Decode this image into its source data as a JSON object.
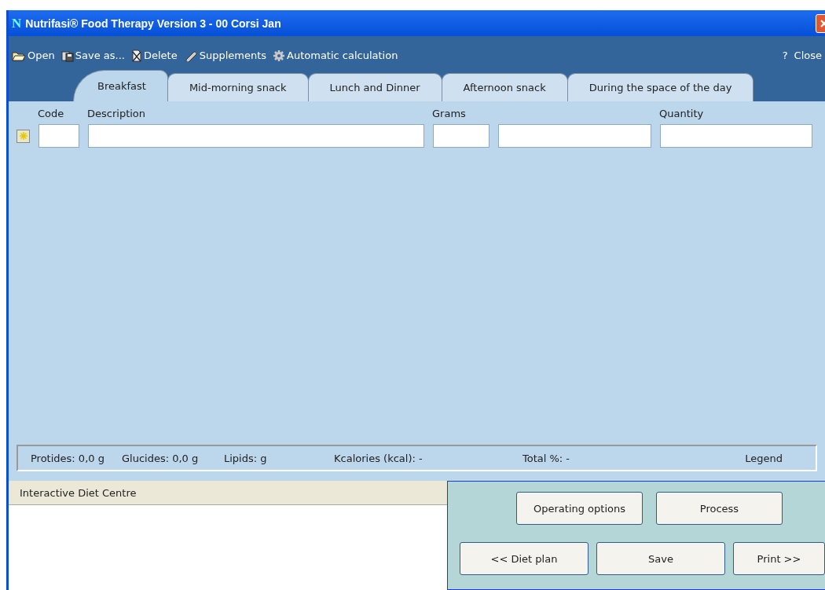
{
  "window": {
    "logo": "N",
    "title": "Nutrifasi® Food Therapy Version 3 - 00 Corsi Jan"
  },
  "toolbar": [
    {
      "label": "Open"
    },
    {
      "label": "Save as..."
    },
    {
      "label": "Delete"
    },
    {
      "label": "Supplements"
    },
    {
      "label": "Automatic calculation"
    }
  ],
  "toolbar_right": [
    "?",
    "Close"
  ],
  "tabs": [
    {
      "label": "Breakfast",
      "selected": true
    },
    {
      "label": "Mid-morning snack",
      "selected": false
    },
    {
      "label": "Lunch and Dinner",
      "selected": false
    },
    {
      "label": "Afternoon snack",
      "selected": false
    },
    {
      "label": "During the space of the day",
      "selected": false
    }
  ],
  "columns": [
    "Code",
    "Description",
    "Grams",
    "",
    "Quantity"
  ],
  "summary": [
    "Protides: 0,0 g",
    "Glucides: 0,0 g",
    "Lipids:  g",
    "Kcalories (kcal): -",
    "Total %: -",
    "Legend"
  ],
  "diet_centre": {
    "title": "Interactive Diet Centre"
  },
  "buttons_top": [
    "Operating options",
    "Process"
  ],
  "buttons_bottom": [
    "<< Diet plan",
    "Save",
    "Print >>"
  ]
}
